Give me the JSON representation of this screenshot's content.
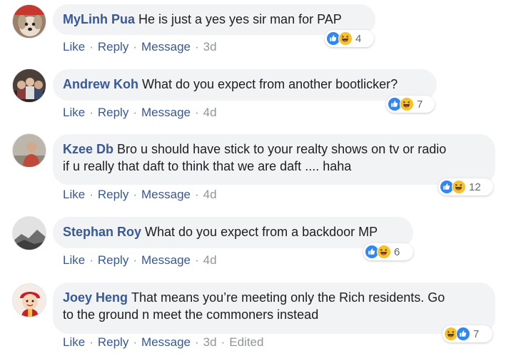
{
  "comments": [
    {
      "author": "MyLinh Pua",
      "text": "He is just a yes yes sir man for PAP",
      "like": "Like",
      "reply": "Reply",
      "message": "Message",
      "time": "3d",
      "edited": "",
      "reaction_count": "4",
      "reactions": [
        "like-icon",
        "haha-icon"
      ]
    },
    {
      "author": "Andrew Koh",
      "text": "What do you expect from another bootlicker?",
      "like": "Like",
      "reply": "Reply",
      "message": "Message",
      "time": "4d",
      "edited": "",
      "reaction_count": "7",
      "reactions": [
        "like-icon",
        "haha-icon"
      ]
    },
    {
      "author": "Kzee Db",
      "text_line1": "Bro u should have stick to your realty shows on tv or radio",
      "text_line2": "if u really that daft to think that we are daft .... haha",
      "like": "Like",
      "reply": "Reply",
      "message": "Message",
      "time": "4d",
      "edited": "",
      "reaction_count": "12",
      "reactions": [
        "like-icon",
        "haha-icon"
      ]
    },
    {
      "author": "Stephan Roy",
      "text": "What do you expect from a backdoor MP",
      "like": "Like",
      "reply": "Reply",
      "message": "Message",
      "time": "4d",
      "edited": "",
      "reaction_count": "6",
      "reactions": [
        "like-icon",
        "haha-icon"
      ]
    },
    {
      "author": "Joey Heng",
      "text_line1": "That means you’re meeting only the Rich residents. Go",
      "text_line2": "to the ground n meet the commoners instead",
      "like": "Like",
      "reply": "Reply",
      "message": "Message",
      "time": "3d",
      "edited": "Edited",
      "reaction_count": "7",
      "reactions": [
        "haha-icon",
        "like-icon"
      ]
    }
  ],
  "colors": {
    "author": "#385898",
    "bubble": "#f2f3f5",
    "meta": "#90949c",
    "like_blue": "#2f86f6",
    "haha_yellow": "#f7c229"
  }
}
